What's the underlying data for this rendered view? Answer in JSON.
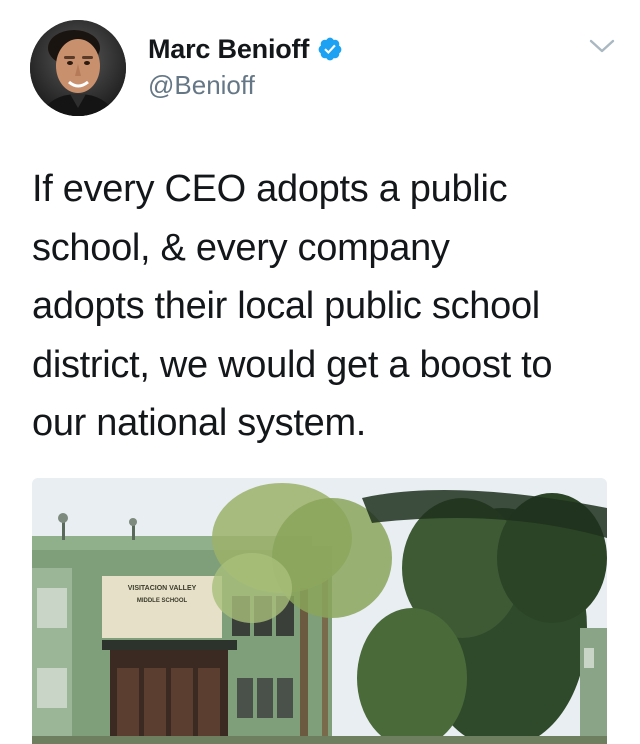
{
  "author": {
    "display_name": "Marc Benioff",
    "handle": "@Benioff",
    "verified": true,
    "verified_color": "#1da1f2"
  },
  "tweet": {
    "text_lines": [
      "If every CEO adopts a public",
      "school, & every company",
      "adopts their local public school",
      "district, we would get a boost to",
      "our national system."
    ]
  },
  "media": {
    "sign_line1": "VISITACION VALLEY",
    "sign_line2": "MIDDLE SCHOOL"
  },
  "icons": {
    "menu": "chevron-down-icon",
    "verified": "verified-badge-icon"
  }
}
